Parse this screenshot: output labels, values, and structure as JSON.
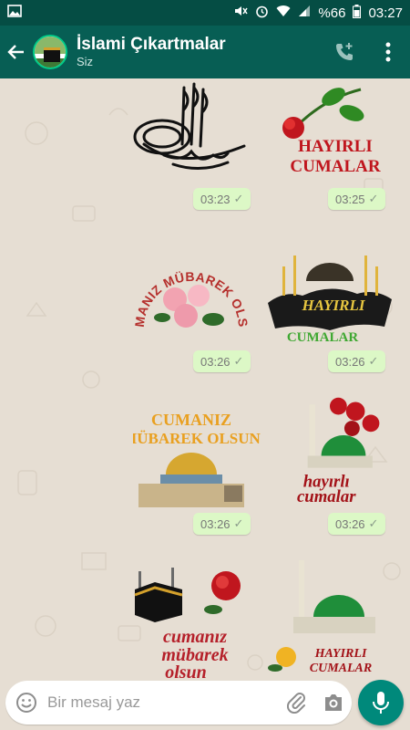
{
  "status_bar": {
    "battery_text": "%66",
    "time": "03:27"
  },
  "header": {
    "title": "İslami Çıkartmalar",
    "subtitle": "Siz"
  },
  "messages": [
    {
      "time": "03:23",
      "sticker": "tughra-calligraphy"
    },
    {
      "time": "03:25",
      "sticker": "rose-hayirli-cumalar",
      "lines": [
        "HAYIRLI",
        "CUMALAR"
      ]
    },
    {
      "time": "03:26",
      "sticker": "roses-cumaniz-mubarek-olsun",
      "arc_text": "CUMANIZ MÜBAREK OLSUN"
    },
    {
      "time": "03:26",
      "sticker": "mosque-hayirli-cumalar",
      "lines": [
        "HAYIRLI",
        "CUMALAR"
      ]
    },
    {
      "time": "03:26",
      "sticker": "dome-cumaniz-mubarek",
      "lines": [
        "CUMANIZ",
        "MÜBAREK OLSUN"
      ]
    },
    {
      "time": "03:26",
      "sticker": "green-dome-hayirli",
      "lines": [
        "hayırlı",
        "cumalar"
      ]
    },
    {
      "sticker": "kaaba-cumaniz",
      "lines": [
        "cumanız",
        "mübarek",
        "olsun"
      ]
    },
    {
      "sticker": "green-dome-rose",
      "lines": [
        "HAYIRLI",
        "CUMALAR"
      ]
    }
  ],
  "input": {
    "placeholder": "Bir mesaj yaz"
  },
  "colors": {
    "header": "#075e54",
    "status_bar": "#054d44",
    "bubble": "#dcf8c6",
    "chat_bg": "#e6ded3",
    "fab": "#00897b"
  }
}
